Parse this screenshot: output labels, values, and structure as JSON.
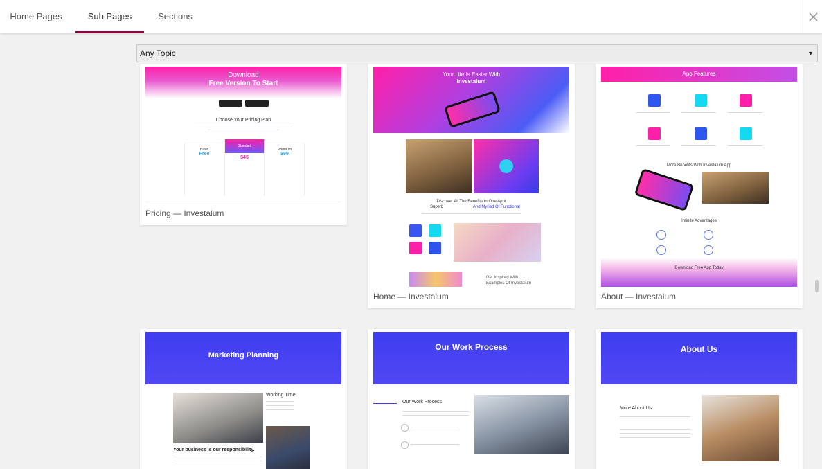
{
  "tabs": [
    {
      "label": "Home Pages"
    },
    {
      "label": "Sub Pages"
    },
    {
      "label": "Sections"
    }
  ],
  "filter": {
    "value": "Any Topic"
  },
  "cards": [
    {
      "label": "Pricing — Investalum",
      "thumb": {
        "download": "Download",
        "free_version": "Free Version To Start",
        "choose_plan": "Choose Your Pricing Plan",
        "plans": [
          {
            "name": "Basic",
            "price": "Free"
          },
          {
            "name": "Standart",
            "price": "$45"
          },
          {
            "name": "Premium",
            "price": "$99"
          }
        ]
      }
    },
    {
      "label": "Home — Investalum",
      "thumb": {
        "hero": "Your Life Is Easier With",
        "brand": "Investalum",
        "benefits": "Discover All The Benefits In One App!",
        "superb": "Superb",
        "myriad": "And Myriad Of Functional",
        "inspired": "Get Inspired With",
        "examples": "Examples Of Investalum"
      }
    },
    {
      "label": "About — Investalum",
      "thumb": {
        "title": "App Features",
        "more": "More Benefits With Investalum App",
        "infinite": "Infinite Advantages",
        "download": "Download Free App Today"
      }
    },
    {
      "label": "",
      "thumb": {
        "title": "Marketing Planning",
        "working": "Working Time",
        "responsibility": "Your business is our responsibility."
      }
    },
    {
      "label": "",
      "thumb": {
        "title": "Our Work Process",
        "work_process": "Our Work Process"
      }
    },
    {
      "label": "",
      "thumb": {
        "title": "About Us",
        "more_about": "More About Us"
      }
    }
  ],
  "colors": {
    "accent": "#93003f",
    "pink": "#ff1fa8",
    "blue": "#4141ef"
  }
}
